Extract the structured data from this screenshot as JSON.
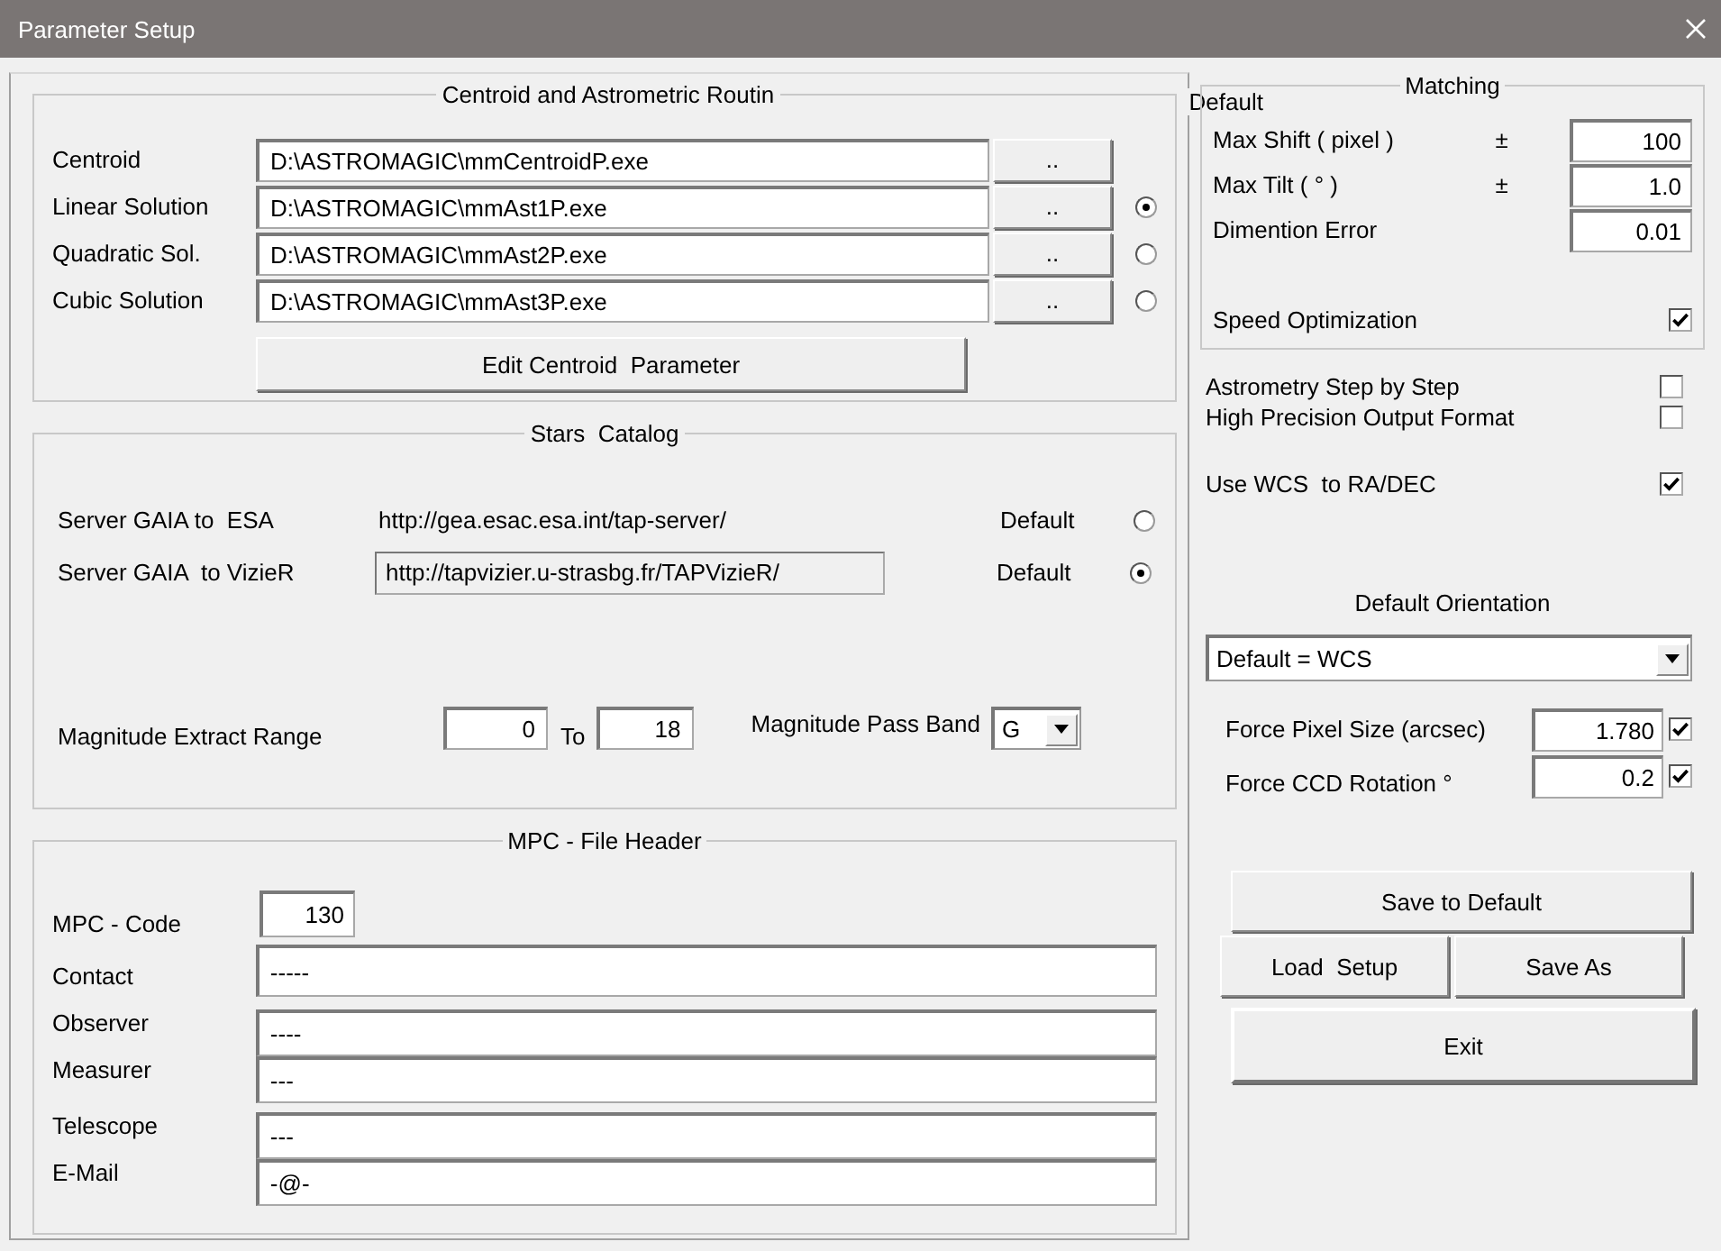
{
  "window": {
    "title": "Parameter Setup"
  },
  "centroid_routines": {
    "title": "Centroid and Astrometric Routin",
    "default_header": "Default",
    "edit_button": "Edit Centroid  Parameter",
    "rows": [
      {
        "label": "Centroid",
        "path": "D:\\ASTROMAGIC\\mmCentroidP.exe",
        "browse": "..",
        "kind": "plain"
      },
      {
        "label": "Linear Solution",
        "path": "D:\\ASTROMAGIC\\mmAst1P.exe",
        "browse": "..",
        "kind": "radio",
        "selected": true
      },
      {
        "label": "Quadratic Sol.",
        "path": "D:\\ASTROMAGIC\\mmAst2P.exe",
        "browse": "..",
        "kind": "radio",
        "selected": false
      },
      {
        "label": "Cubic Solution",
        "path": "D:\\ASTROMAGIC\\mmAst3P.exe",
        "browse": "..",
        "kind": "radio",
        "selected": false
      }
    ]
  },
  "stars_catalog": {
    "title": "Stars  Catalog",
    "servers": [
      {
        "label": "Server GAIA to  ESA",
        "url": "http://gea.esac.esa.int/tap-server/",
        "kind": "text",
        "default_label": "Default",
        "selected": false
      },
      {
        "label": "Server GAIA  to VizieR",
        "url": "http://tapvizier.u-strasbg.fr/TAPVizieR/",
        "kind": "field",
        "default_label": "Default",
        "selected": true
      }
    ],
    "magnitude_range": {
      "label": "Magnitude Extract Range",
      "from": "0",
      "to_label": "To",
      "to": "18"
    },
    "pass_band": {
      "label": "Magnitude Pass Band",
      "value": "G"
    }
  },
  "mpc_header": {
    "title": "MPC - File Header",
    "fields": [
      {
        "label": "MPC - Code",
        "value": "130",
        "kind": "short"
      },
      {
        "label": "Contact",
        "value": "-----",
        "kind": "tall"
      },
      {
        "label": "Observer",
        "value": "----",
        "kind": "wide"
      },
      {
        "label": "Measurer",
        "value": "---",
        "kind": "wide"
      },
      {
        "label": "Telescope",
        "value": "---",
        "kind": "wide"
      },
      {
        "label": "E-Mail",
        "value": "-@-",
        "kind": "wide"
      }
    ]
  },
  "matching": {
    "title": "Matching",
    "fields": [
      {
        "label": "Max Shift ( pixel )",
        "sign": "±",
        "value": "100"
      },
      {
        "label": "Max Tilt ( ° )",
        "sign": "±",
        "value": "1.0"
      },
      {
        "label": "Dimention Error",
        "value": "0.01"
      }
    ],
    "speed_optimization": {
      "label": "Speed Optimization",
      "checked": true
    }
  },
  "options": [
    {
      "label": "Astrometry Step by Step",
      "checked": false
    },
    {
      "label": "High Precision Output Format",
      "checked": false
    },
    {
      "label": "Use WCS  to RA/DEC",
      "checked": true
    }
  ],
  "orientation": {
    "title": "Default Orientation",
    "value": "Default = WCS"
  },
  "forced": [
    {
      "label": "Force Pixel Size (arcsec)",
      "value": "1.780",
      "checked": true
    },
    {
      "label": "Force CCD Rotation °",
      "value": "0.2",
      "checked": true
    }
  ],
  "buttons": {
    "save_default": "Save to Default",
    "load": "Load  Setup",
    "save_as": "Save As",
    "exit": "Exit"
  }
}
